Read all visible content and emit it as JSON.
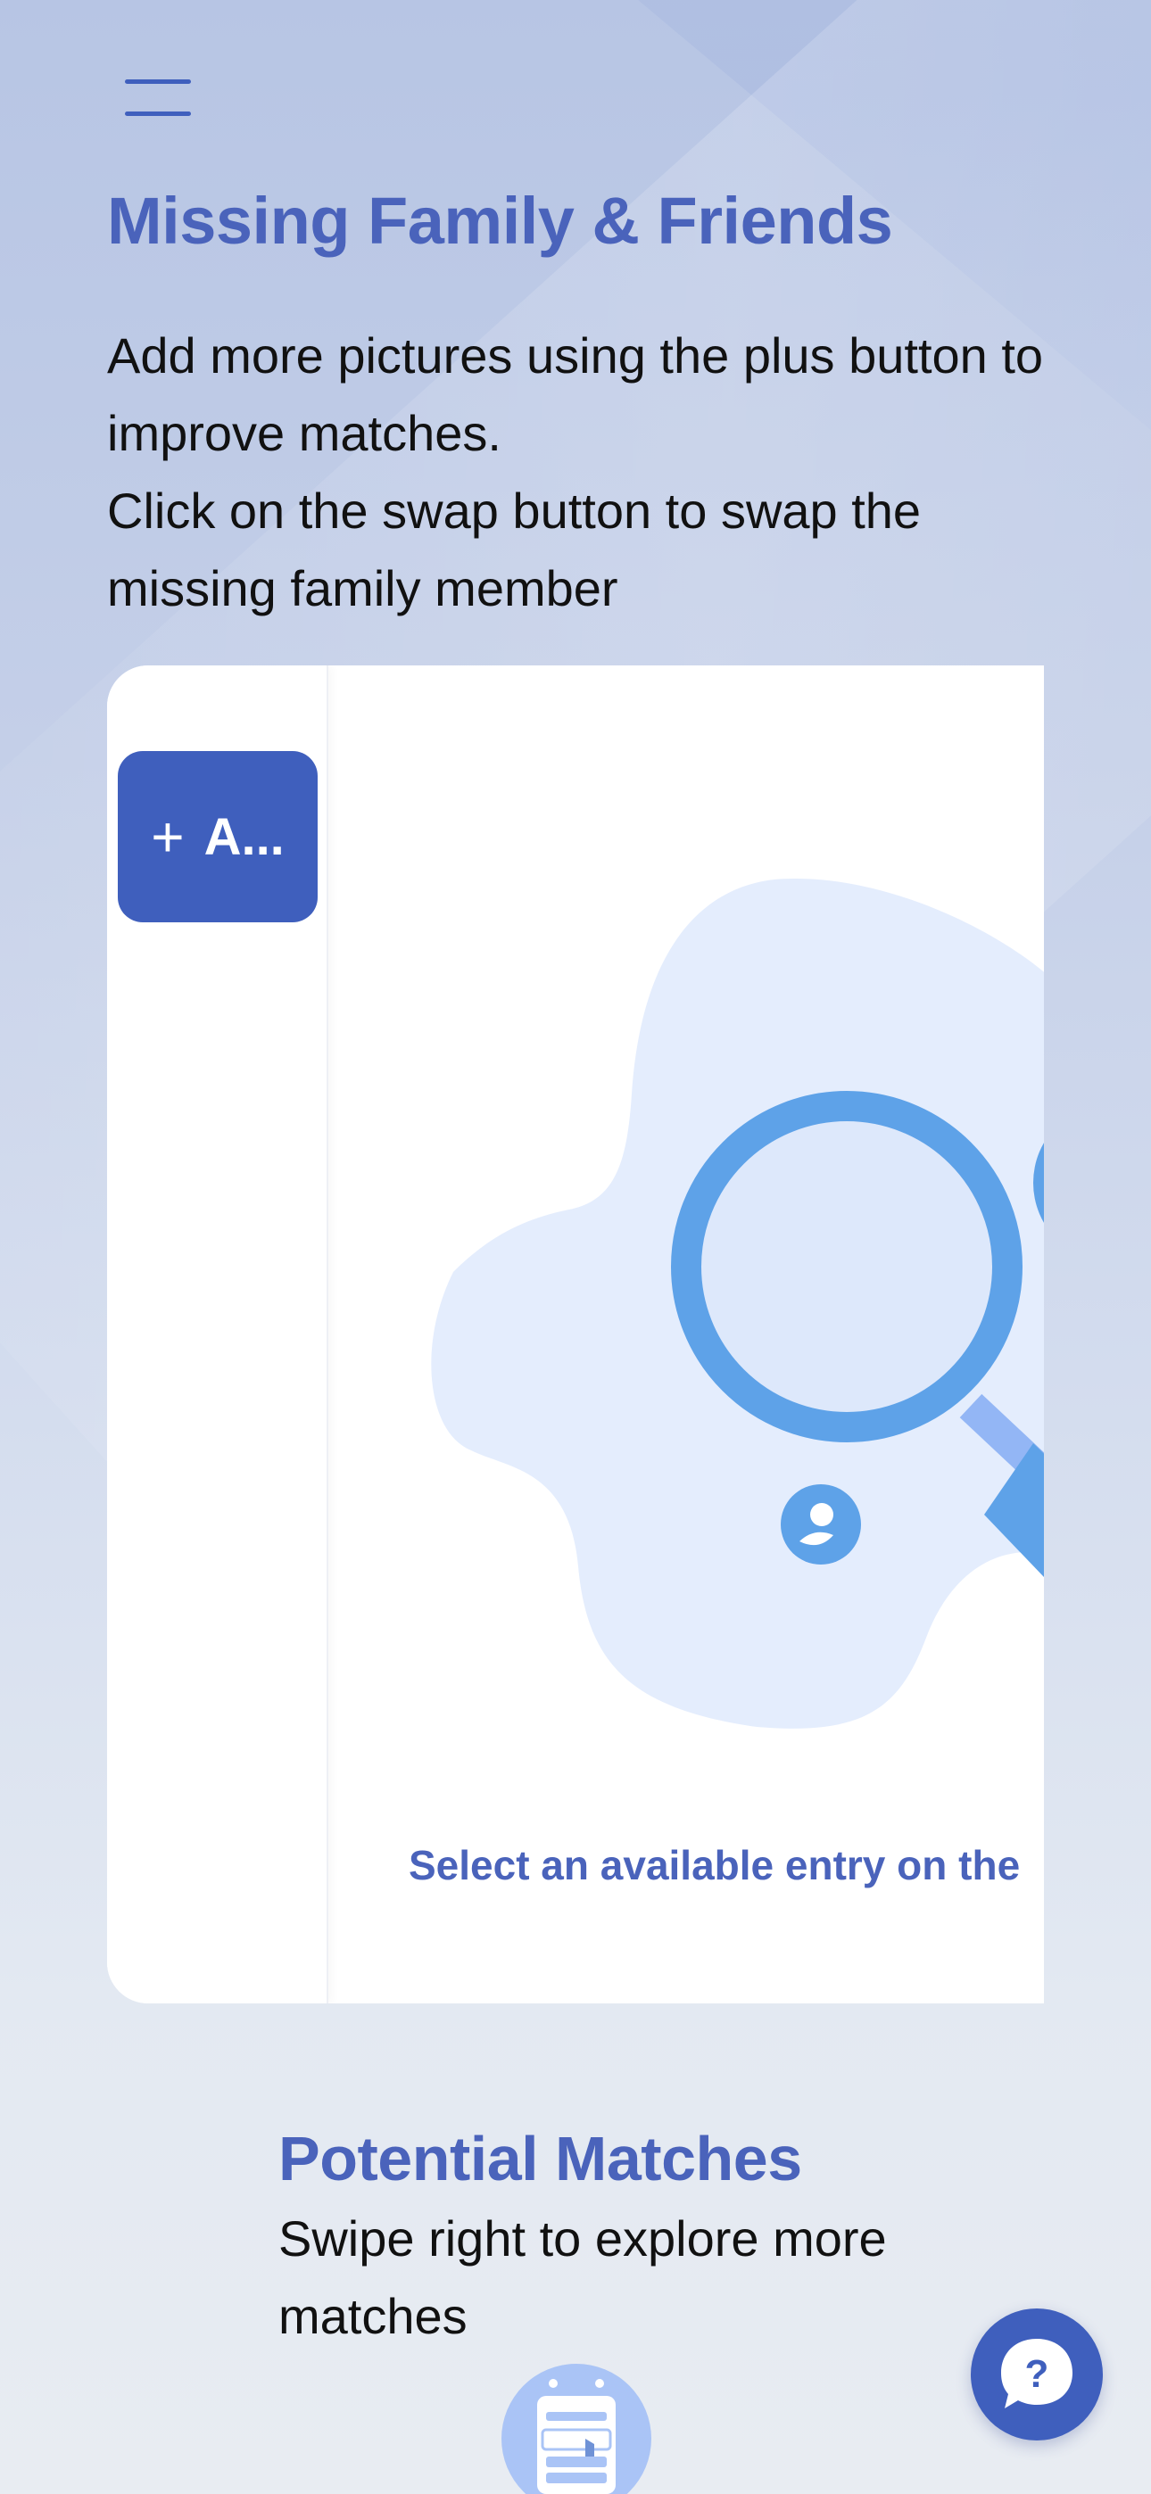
{
  "header": {
    "menu_icon": "hamburger-menu-icon"
  },
  "page": {
    "title": "Missing Family & Friends",
    "instructions": [
      "Add more pictures using the plus button to improve matches.",
      "Click on the swap button to swap the missing family member"
    ]
  },
  "card": {
    "add_button_icon": "plus-icon",
    "add_button_label": "A...",
    "illustration_icon": "magnifying-glass-people-icon",
    "empty_hint": "Select an available entry on the"
  },
  "matches": {
    "title": "Potential Matches",
    "subtitle": "Swipe right to explore more matches",
    "icon": "swipe-card-icon"
  },
  "help": {
    "icon": "question-chat-icon",
    "glyph": "?"
  },
  "colors": {
    "brand": "#3f5fbd",
    "heading": "#4a63bb",
    "illustration_blob": "#e4edfd",
    "illustration_accent": "#5ea2e8"
  }
}
